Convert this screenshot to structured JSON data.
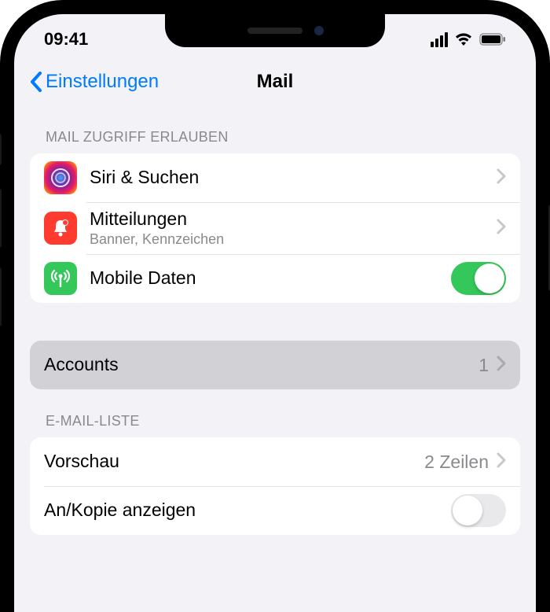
{
  "status": {
    "time": "09:41"
  },
  "nav": {
    "back_label": "Einstellungen",
    "title": "Mail"
  },
  "sections": {
    "allow_access": {
      "header": "MAIL ZUGRIFF ERLAUBEN",
      "siri": {
        "label": "Siri & Suchen"
      },
      "notifications": {
        "label": "Mitteilungen",
        "sublabel": "Banner, Kennzeichen"
      },
      "cellular": {
        "label": "Mobile Daten",
        "on": true
      }
    },
    "accounts": {
      "label": "Accounts",
      "value": "1"
    },
    "email_list": {
      "header": "E-MAIL-LISTE",
      "preview": {
        "label": "Vorschau",
        "value": "2 Zeilen"
      },
      "to_cc": {
        "label": "An/Kopie anzeigen",
        "on": false
      }
    }
  }
}
